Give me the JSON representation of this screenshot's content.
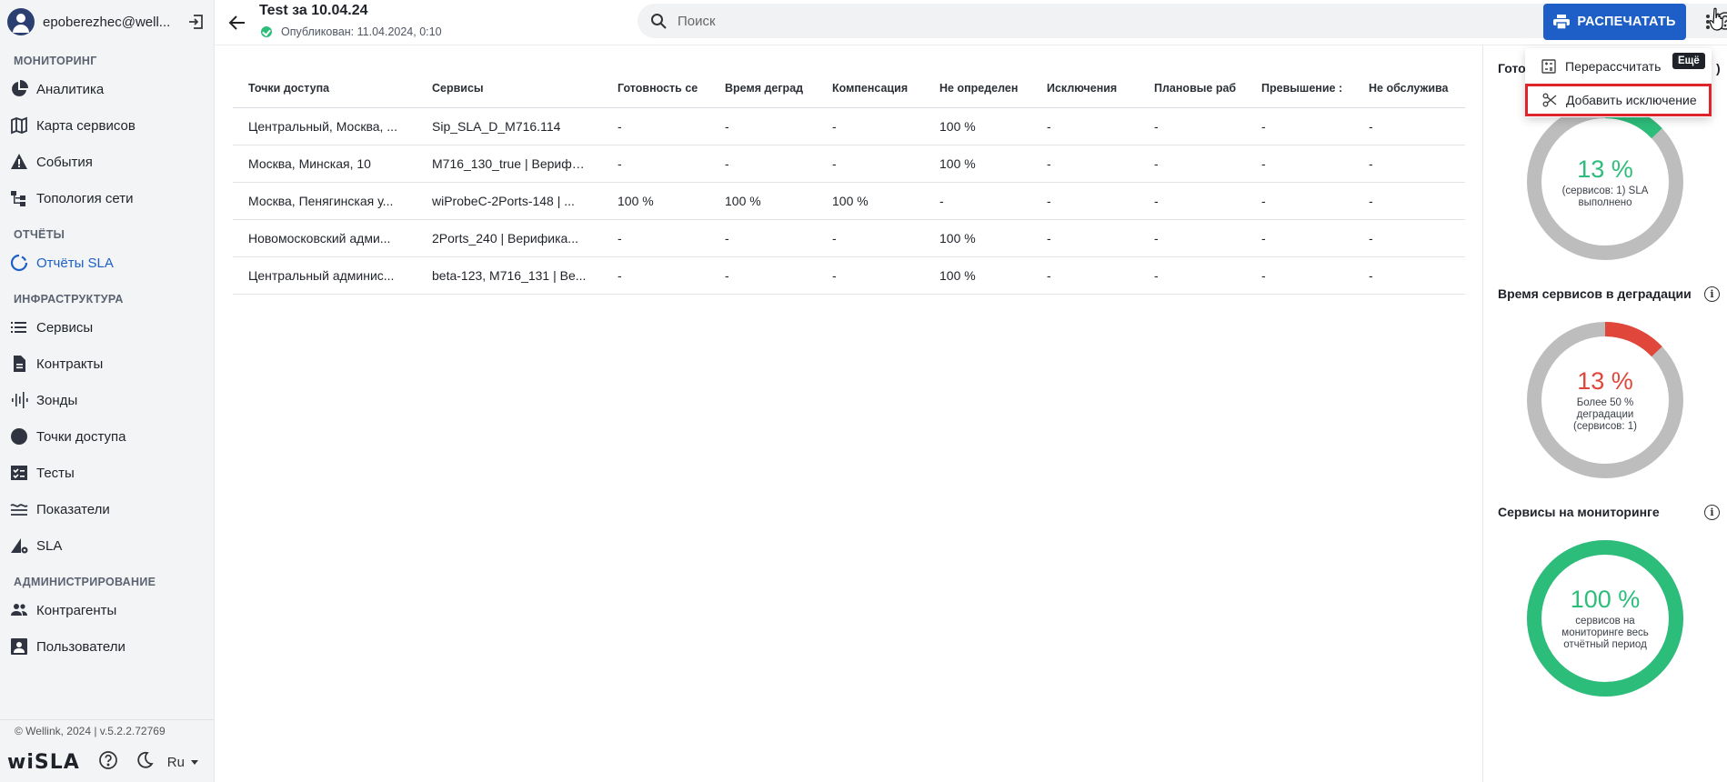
{
  "sidebar": {
    "user_email": "epoberezhec@well...",
    "sections": {
      "monitoring": "МОНИТОРИНГ",
      "reports": "ОТЧЁТЫ",
      "infrastructure": "ИНФРАСТРУКТУРА",
      "administration": "АДМИНИСТРИРОВАНИЕ"
    },
    "items": {
      "analytics": "Аналитика",
      "service_map": "Карта сервисов",
      "events": "События",
      "topology": "Топология сети",
      "sla_reports": "Отчёты SLA",
      "services": "Сервисы",
      "contracts": "Контракты",
      "probes": "Зонды",
      "access_points": "Точки доступа",
      "tests": "Тесты",
      "indicators": "Показатели",
      "sla": "SLA",
      "contractors": "Контрагенты",
      "users": "Пользователи"
    },
    "copyright": "© Wellink, 2024 | v.5.2.2.72769",
    "logo": "wiSLA",
    "lang": "Ru"
  },
  "header": {
    "title": "Test за 10.04.24",
    "published": "Опубликован: 11.04.2024, 0:10",
    "search_placeholder": "Поиск",
    "print_label": "РАСПЕЧАТАТЬ"
  },
  "table": {
    "columns": [
      "Точки доступа",
      "Сервисы",
      "Готовность се",
      "Время деград",
      "Компенсация",
      "Не определен",
      "Исключения",
      "Плановые раб",
      "Превышение :",
      "Не обслужива"
    ],
    "rows": [
      [
        "Центральный, Москва, ...",
        "Sip_SLA_D_M716.114",
        "-",
        "-",
        "-",
        "100 %",
        "-",
        "-",
        "-",
        "-"
      ],
      [
        "Москва, Минская, 10",
        "M716_130_true | Верифи...",
        "-",
        "-",
        "-",
        "100 %",
        "-",
        "-",
        "-",
        "-"
      ],
      [
        "Москва, Пенягинская у...",
        "wiProbeC-2Ports-148 | ...",
        "100 %",
        "100 %",
        "100 %",
        "-",
        "-",
        "-",
        "-",
        "-"
      ],
      [
        "Новомосковский адми...",
        "2Ports_240 | Верифика...",
        "-",
        "-",
        "-",
        "100 %",
        "-",
        "-",
        "-",
        "-"
      ],
      [
        "Центральный админис...",
        "beta-123, M716_131 | Be...",
        "-",
        "-",
        "-",
        "100 %",
        "-",
        "-",
        "-",
        "-"
      ]
    ]
  },
  "widgets": [
    {
      "title": "Готов",
      "title_tail": ")",
      "percent_label": "13 %",
      "percent": 13,
      "caption": "(сервисов: 1) SLA выполнено",
      "color": "#2dbd7a"
    },
    {
      "title": "Время сервисов в деградации",
      "percent_label": "13 %",
      "percent": 13,
      "caption": "Более 50 % деградации (сервисов: 1)",
      "color": "#e0463a"
    },
    {
      "title": "Сервисы на мониторинге",
      "percent_label": "100 %",
      "percent": 100,
      "caption": "сервисов на мониторинге весь отчётный период",
      "color": "#2dbd7a"
    }
  ],
  "menu": {
    "recalculate": "Перерассчитать",
    "add_exception": "Добавить исключение",
    "tooltip": "Ещё"
  },
  "colors": {
    "accent": "#1d5fc6",
    "success": "#2dbd7a",
    "danger": "#e0463a",
    "ring_bg": "#bdbdbd",
    "highlight": "#e0242b"
  }
}
